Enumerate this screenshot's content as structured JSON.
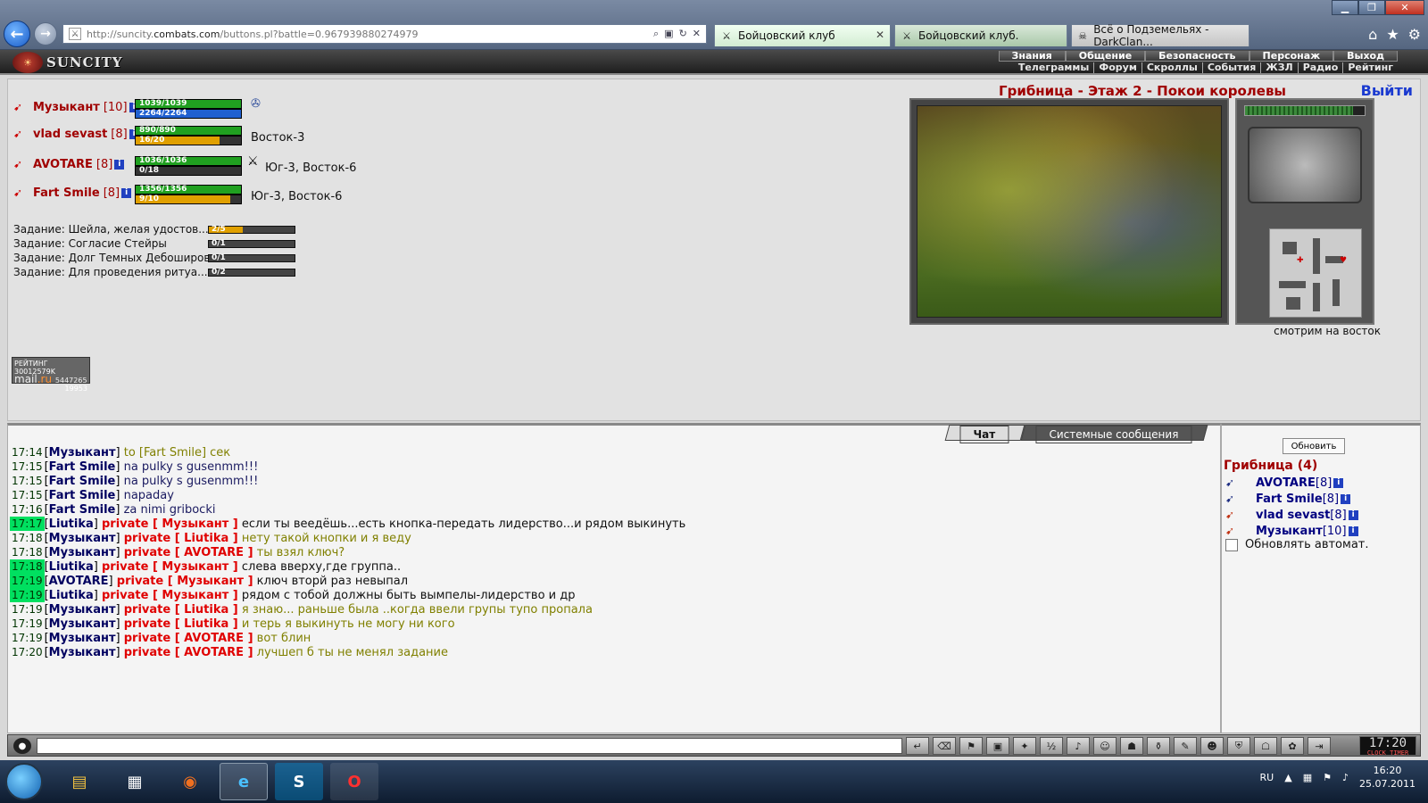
{
  "browser": {
    "url_prefix": "http://suncity.",
    "url_domain": "combats.com",
    "url_suffix": "/buttons.pl?battle=0.967939880274979",
    "tabs": [
      {
        "label": "Бойцовский клуб"
      },
      {
        "label": "Бойцовский клуб."
      },
      {
        "label": "Всё о Подземельях - DarkClan..."
      }
    ]
  },
  "game": {
    "logo": "SUNCITY",
    "menu_top": [
      "Знания",
      "Общение",
      "Безопасность",
      "Персонаж",
      "Выход"
    ],
    "menu_bottom": [
      "Телеграммы",
      "Форум",
      "Скроллы",
      "События",
      "ЖЗЛ",
      "Радио",
      "Рейтинг"
    ],
    "location_title": "Грибница - Этаж 2 - Покои королевы",
    "exit_label": "Выйти",
    "look_direction": "смотрим на восток",
    "players": [
      {
        "name": "Музыкант",
        "level": "[10]",
        "hp": "1039/1039",
        "hp_frac": 1.0,
        "mana": "2264/2264",
        "mana_frac": 1.0,
        "mana_color": "#2060d0",
        "location": ""
      },
      {
        "name": "vlad sevast",
        "level": "[8]",
        "hp": "890/890",
        "hp_frac": 1.0,
        "mana": "16/20",
        "mana_frac": 0.8,
        "mana_color": "#e0a000",
        "location": "Восток-3"
      },
      {
        "name": "AVOTARE",
        "level": "[8]",
        "hp": "1036/1036",
        "hp_frac": 1.0,
        "mana": "0/18",
        "mana_frac": 0.0,
        "mana_color": "#e0a000",
        "location": "Юг-3, Восток-6"
      },
      {
        "name": "Fart Smile",
        "level": "[8]",
        "hp": "1356/1356",
        "hp_frac": 1.0,
        "mana": "9/10",
        "mana_frac": 0.9,
        "mana_color": "#e0a000",
        "location": "Юг-3, Восток-6"
      }
    ],
    "quests": [
      {
        "text": "Задание: Шейла, желая удостов...",
        "progress": "2/5",
        "frac": 0.4
      },
      {
        "text": "Задание:            Согласие Стейры",
        "progress": "0/1",
        "frac": 0.0
      },
      {
        "text": "Задание: Долг Темных Дебоширов",
        "progress": "0/1",
        "frac": 0.0
      },
      {
        "text": "Задание: Для проведения ритуа...",
        "progress": "0/2",
        "frac": 0.0
      }
    ],
    "rating": {
      "line1": "РЕЙТИНГ 30012579K",
      "mail1": "mail",
      "mail2": ".ru",
      "n1": "5447265",
      "n2": "19953"
    }
  },
  "chat": {
    "tab_chat": "Чат",
    "tab_system": "Системные сообщения",
    "messages": [
      {
        "time": "17:14",
        "hl": false,
        "who": "Музыкант",
        "pre": " to [Fart Smile] ",
        "text": "сек",
        "cls": "tx"
      },
      {
        "time": "17:15",
        "hl": false,
        "who": "Fart Smile",
        "pre": "",
        "text": "na pulky s gusenmm!!!",
        "cls": "tx b"
      },
      {
        "time": "17:15",
        "hl": false,
        "who": "Fart Smile",
        "pre": "",
        "text": "na pulky s gusenmm!!!",
        "cls": "tx b"
      },
      {
        "time": "17:15",
        "hl": false,
        "who": "Fart Smile",
        "pre": "",
        "text": "napaday",
        "cls": "tx b"
      },
      {
        "time": "17:16",
        "hl": false,
        "who": "Fart Smile",
        "pre": "",
        "text": "za nimi gribocki",
        "cls": "tx b"
      },
      {
        "time": "17:17",
        "hl": true,
        "who": "Liutika",
        "pre": "private [ Музыкант ]",
        "text": "если ты веедёшь...есть кнопка-передать лидерство...и рядом выкинуть",
        "cls": "tx k"
      },
      {
        "time": "17:18",
        "hl": false,
        "who": "Музыкант",
        "pre": "private [ Liutika ]",
        "text": "нету такой кнопки и я веду",
        "cls": "tx"
      },
      {
        "time": "17:18",
        "hl": false,
        "who": "Музыкант",
        "pre": "private [ AVOTARE ]",
        "text": "ты взял ключ?",
        "cls": "tx"
      },
      {
        "time": "17:18",
        "hl": true,
        "who": "Liutika",
        "pre": "private [ Музыкант ]",
        "text": "слева вверху,где группа..",
        "cls": "tx k"
      },
      {
        "time": "17:19",
        "hl": true,
        "who": "AVOTARE",
        "pre": "private [ Музыкант ]",
        "text": "ключ вторй раз невыпал",
        "cls": "tx k"
      },
      {
        "time": "17:19",
        "hl": true,
        "who": "Liutika",
        "pre": "private [ Музыкант ]",
        "text": "рядом с тобой должны быть вымпелы-лидерство и др",
        "cls": "tx k"
      },
      {
        "time": "17:19",
        "hl": false,
        "who": "Музыкант",
        "pre": "private [ Liutika ]",
        "text": "я знаю... раньше была ..когда ввели групы тупо пропала",
        "cls": "tx"
      },
      {
        "time": "17:19",
        "hl": false,
        "who": "Музыкант",
        "pre": "private [ Liutika ]",
        "text": "и терь я выкинуть не могу ни кого",
        "cls": "tx"
      },
      {
        "time": "17:19",
        "hl": false,
        "who": "Музыкант",
        "pre": "private [ AVOTARE ]",
        "text": "вот блин",
        "cls": "tx"
      },
      {
        "time": "17:20",
        "hl": false,
        "who": "Музыкант",
        "pre": "private [ AVOTARE ]",
        "text": "лучшеп б ты не менял задание",
        "cls": "tx"
      }
    ]
  },
  "roster": {
    "refresh_label": "Обновить",
    "title": "Грибница (4)",
    "members": [
      {
        "name": "AVOTARE",
        "level": "[8]",
        "icon_kind": "b"
      },
      {
        "name": "Fart Smile",
        "level": "[8]",
        "icon_kind": "b"
      },
      {
        "name": "vlad sevast",
        "level": "[8]",
        "icon_kind": "r"
      },
      {
        "name": "Музыкант",
        "level": "[10]",
        "icon_kind": "r"
      }
    ],
    "auto_label": "Обновлять автомат."
  },
  "bottom": {
    "clock": "17:20",
    "clock_sub": "CLOCK TIMER"
  },
  "taskbar": {
    "lang": "RU",
    "time": "16:20",
    "date": "25.07.2011"
  }
}
